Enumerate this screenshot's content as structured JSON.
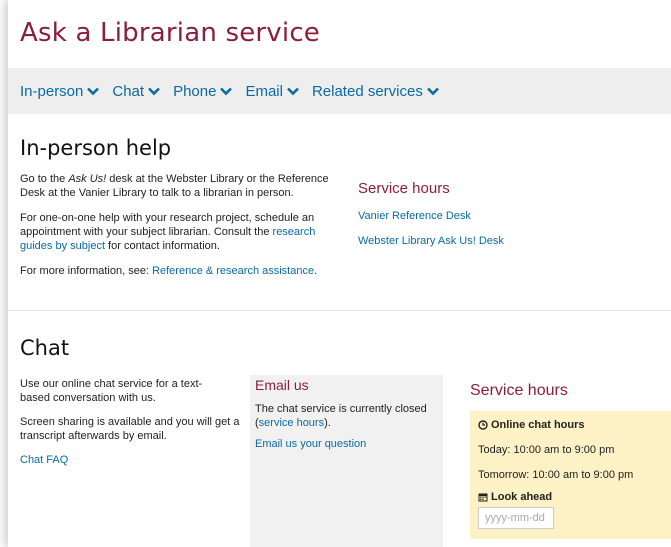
{
  "header": {
    "title": "Ask a Librarian service"
  },
  "nav": {
    "items": [
      {
        "label": "In-person"
      },
      {
        "label": "Chat"
      },
      {
        "label": "Phone"
      },
      {
        "label": "Email"
      },
      {
        "label": "Related services"
      }
    ]
  },
  "inperson": {
    "heading": "In-person help",
    "p1": {
      "before": "Go to the ",
      "emph": "Ask Us!",
      "after": " desk at the Webster Library or the Reference Desk at the Vanier Library to talk to a librarian in person."
    },
    "p2": {
      "before": "For one-on-one help with your research project, schedule an appointment with your subject librarian. Consult the ",
      "link": "research guides by subject",
      "after": " for contact information."
    },
    "p3": {
      "before": "For more information, see: ",
      "link": "Reference & research assistance",
      "after": "."
    },
    "hours": {
      "heading": "Service hours",
      "links": [
        "Vanier Reference Desk",
        "Webster Library Ask Us! Desk"
      ]
    }
  },
  "chat": {
    "heading": "Chat",
    "p1": "Use our online chat service for a text-based conversation with us.",
    "p2": "Screen sharing is available and you will get a transcript afterwards by email.",
    "faq_link": "Chat FAQ",
    "email_box": {
      "heading": "Email us",
      "status_before": "The chat service is currently closed (",
      "status_link": "service hours",
      "status_after": ").",
      "question_link": "Email us your question"
    },
    "hours": {
      "heading": "Service hours",
      "online_label": "Online chat hours",
      "today": "Today: 10:00 am to 9:00 pm",
      "tomorrow": "Tomorrow: 10:00 am to 9:00 pm",
      "lookahead_label": "Look ahead",
      "date_placeholder": "yyyy-mm-dd"
    }
  },
  "colors": {
    "brand": "#8b1f3b",
    "link": "#0a6aa1",
    "hours_bg": "#fdf1c6",
    "nav_bg": "#eeeeee"
  }
}
